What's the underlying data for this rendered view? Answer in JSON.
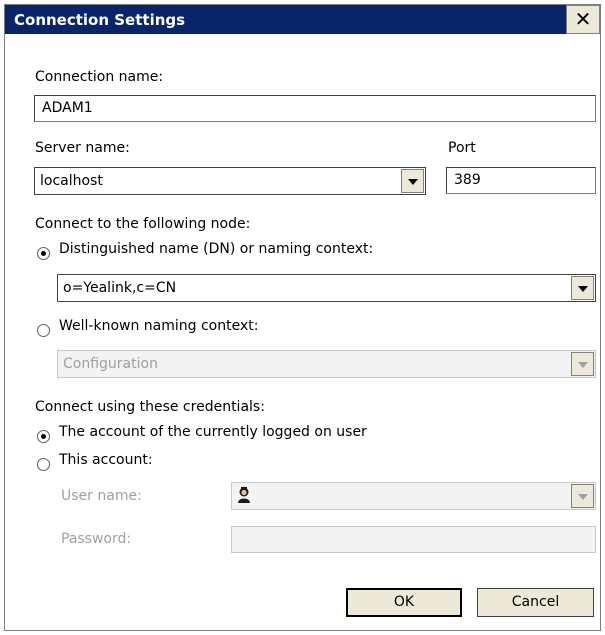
{
  "dialog": {
    "title": "Connection Settings",
    "close_glyph": "✕"
  },
  "connection_name": {
    "label": "Connection name:",
    "value": "ADAM1"
  },
  "server": {
    "label": "Server name:",
    "value": "localhost"
  },
  "port": {
    "label": "Port",
    "value": "389"
  },
  "node": {
    "heading": "Connect to the following node:",
    "dn_option": {
      "label": "Distinguished name (DN) or naming context:",
      "selected": true,
      "value": "o=Yealink,c=CN"
    },
    "wellknown_option": {
      "label": "Well-known naming context:",
      "selected": false,
      "value": "Configuration"
    }
  },
  "credentials": {
    "heading": "Connect using these credentials:",
    "current_user_option": {
      "label": "The account of the currently logged on user",
      "selected": true
    },
    "this_account_option": {
      "label": "This account:",
      "selected": false
    },
    "user_name": {
      "label": "User name:",
      "value": "",
      "icon": "user-account-icon"
    },
    "password": {
      "label": "Password:",
      "value": ""
    }
  },
  "buttons": {
    "ok": "OK",
    "cancel": "Cancel"
  },
  "colors": {
    "titlebar": "#0a246a",
    "button_face": "#ece9d8",
    "disabled_text": "#a0a0a0"
  }
}
